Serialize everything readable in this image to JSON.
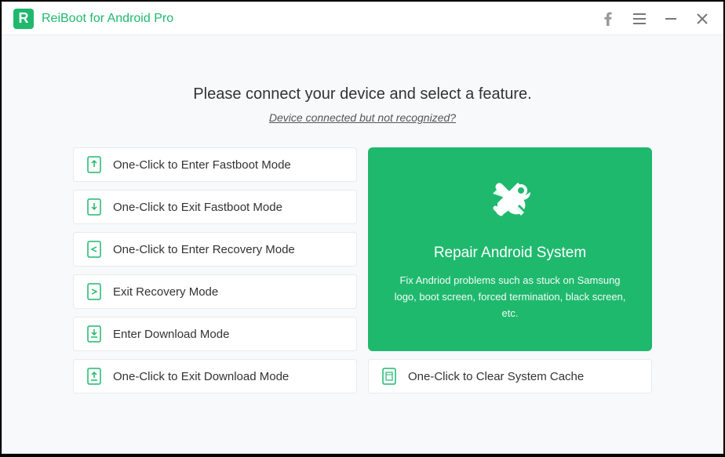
{
  "titlebar": {
    "app_name": "ReiBoot for Android Pro"
  },
  "main": {
    "headline": "Please connect your device and select a feature.",
    "sublink": "Device connected but not recognized?"
  },
  "options": {
    "enter_fastboot": "One-Click to Enter Fastboot Mode",
    "exit_fastboot": "One-Click to Exit Fastboot Mode",
    "enter_recovery": "One-Click to Enter Recovery Mode",
    "exit_recovery": "Exit Recovery Mode",
    "enter_download": "Enter Download Mode",
    "exit_download": "One-Click to Exit Download Mode",
    "clear_cache": "One-Click to Clear System Cache"
  },
  "repair_card": {
    "title": "Repair Android System",
    "desc": "Fix Andriod problems such as stuck on Samsung logo, boot screen, forced termination, black screen, etc."
  }
}
